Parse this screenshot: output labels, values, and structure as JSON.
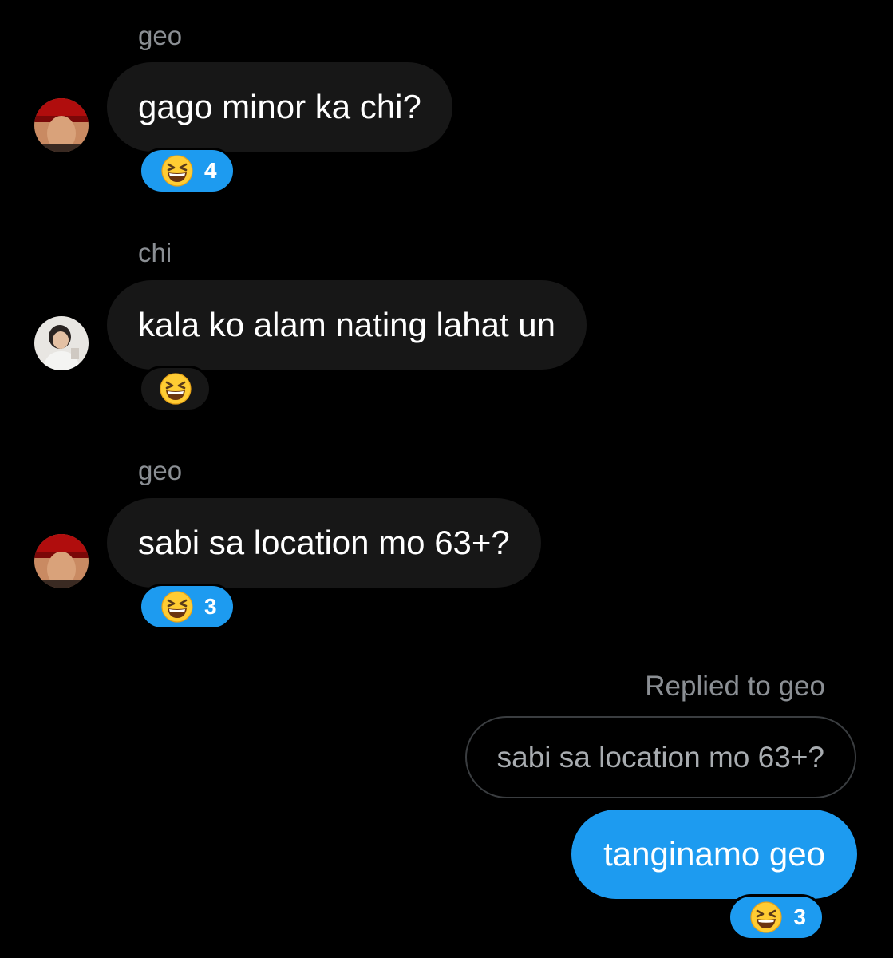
{
  "messages": [
    {
      "sender": "geo",
      "avatar_icon": "geo-avatar",
      "text": "gago minor ka chi?",
      "reaction": {
        "emoji_icon": "grinning-squinting-face-emoji",
        "count": "4",
        "active": true
      }
    },
    {
      "sender": "chi",
      "avatar_icon": "chi-avatar",
      "text": "kala ko alam nating lahat un",
      "reaction": {
        "emoji_icon": "grinning-squinting-face-emoji",
        "count": "",
        "active": false
      }
    },
    {
      "sender": "geo",
      "avatar_icon": "geo-avatar",
      "text": "sabi sa location mo 63+?",
      "reaction": {
        "emoji_icon": "grinning-squinting-face-emoji",
        "count": "3",
        "active": true
      }
    }
  ],
  "own_reply": {
    "reply_label": "Replied to geo",
    "quoted_text": "sabi sa location mo 63+?",
    "text": "tanginamo geo",
    "reaction": {
      "emoji_icon": "grinning-squinting-face-emoji",
      "count": "3",
      "active": true
    }
  },
  "colors": {
    "background": "#000000",
    "incoming_bubble": "#171717",
    "outgoing_bubble": "#1d9bf0",
    "muted_text": "#8b8f94"
  }
}
